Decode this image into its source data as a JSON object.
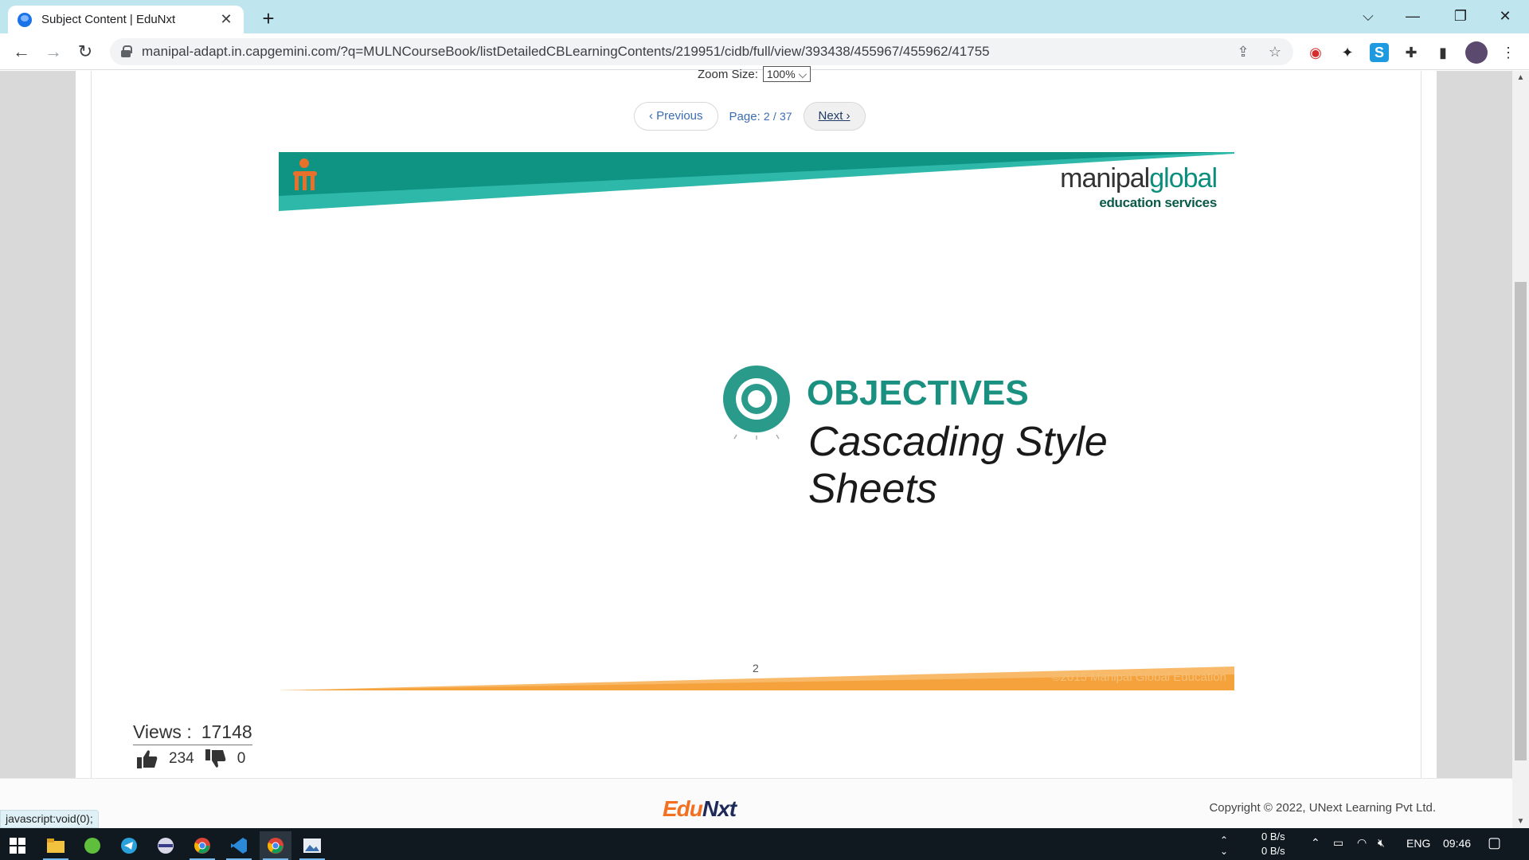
{
  "browser": {
    "tab_title": "Subject Content | EduNxt",
    "tab_close": "✕",
    "new_tab": "+",
    "url": "manipal-adapt.in.capgemini.com/?q=MULNCourseBook/listDetailedCBLearningContents/219951/cidb/full/view/393438/455967/455962/41755",
    "status_url": "javascript:void(0);"
  },
  "viewer": {
    "zoom_label": "Zoom Size:",
    "zoom_value": "100%",
    "prev_label": "‹ Previous",
    "page_label": "Page:",
    "page_current": "2",
    "page_sep": "/",
    "page_total": "37",
    "next_label": "Next ›"
  },
  "slide": {
    "brand_a": "manipal",
    "brand_b": "global",
    "brand_sub": "education services",
    "objectives": "OBJECTIVES",
    "subtitle": "Cascading Style Sheets",
    "number": "2",
    "copyright": "©2015 Manipal Global Education"
  },
  "stats": {
    "views_label": "Views :",
    "views_value": "17148",
    "likes": "234",
    "dislikes": "0"
  },
  "footer": {
    "logo_a": "Edu",
    "logo_b": "N",
    "logo_c": "xt",
    "copyright": "Copyright © 2022, UNext Learning Pvt Ltd."
  },
  "taskbar": {
    "net_up": "0 B/s",
    "net_down": "0 B/s",
    "lang": "ENG",
    "time": "09:46"
  },
  "colors": {
    "teal": "#0f9382",
    "teal_light": "#2db8aa",
    "orange": "#f5a23c",
    "chrome_tab_bg": "#bfe6ef"
  }
}
